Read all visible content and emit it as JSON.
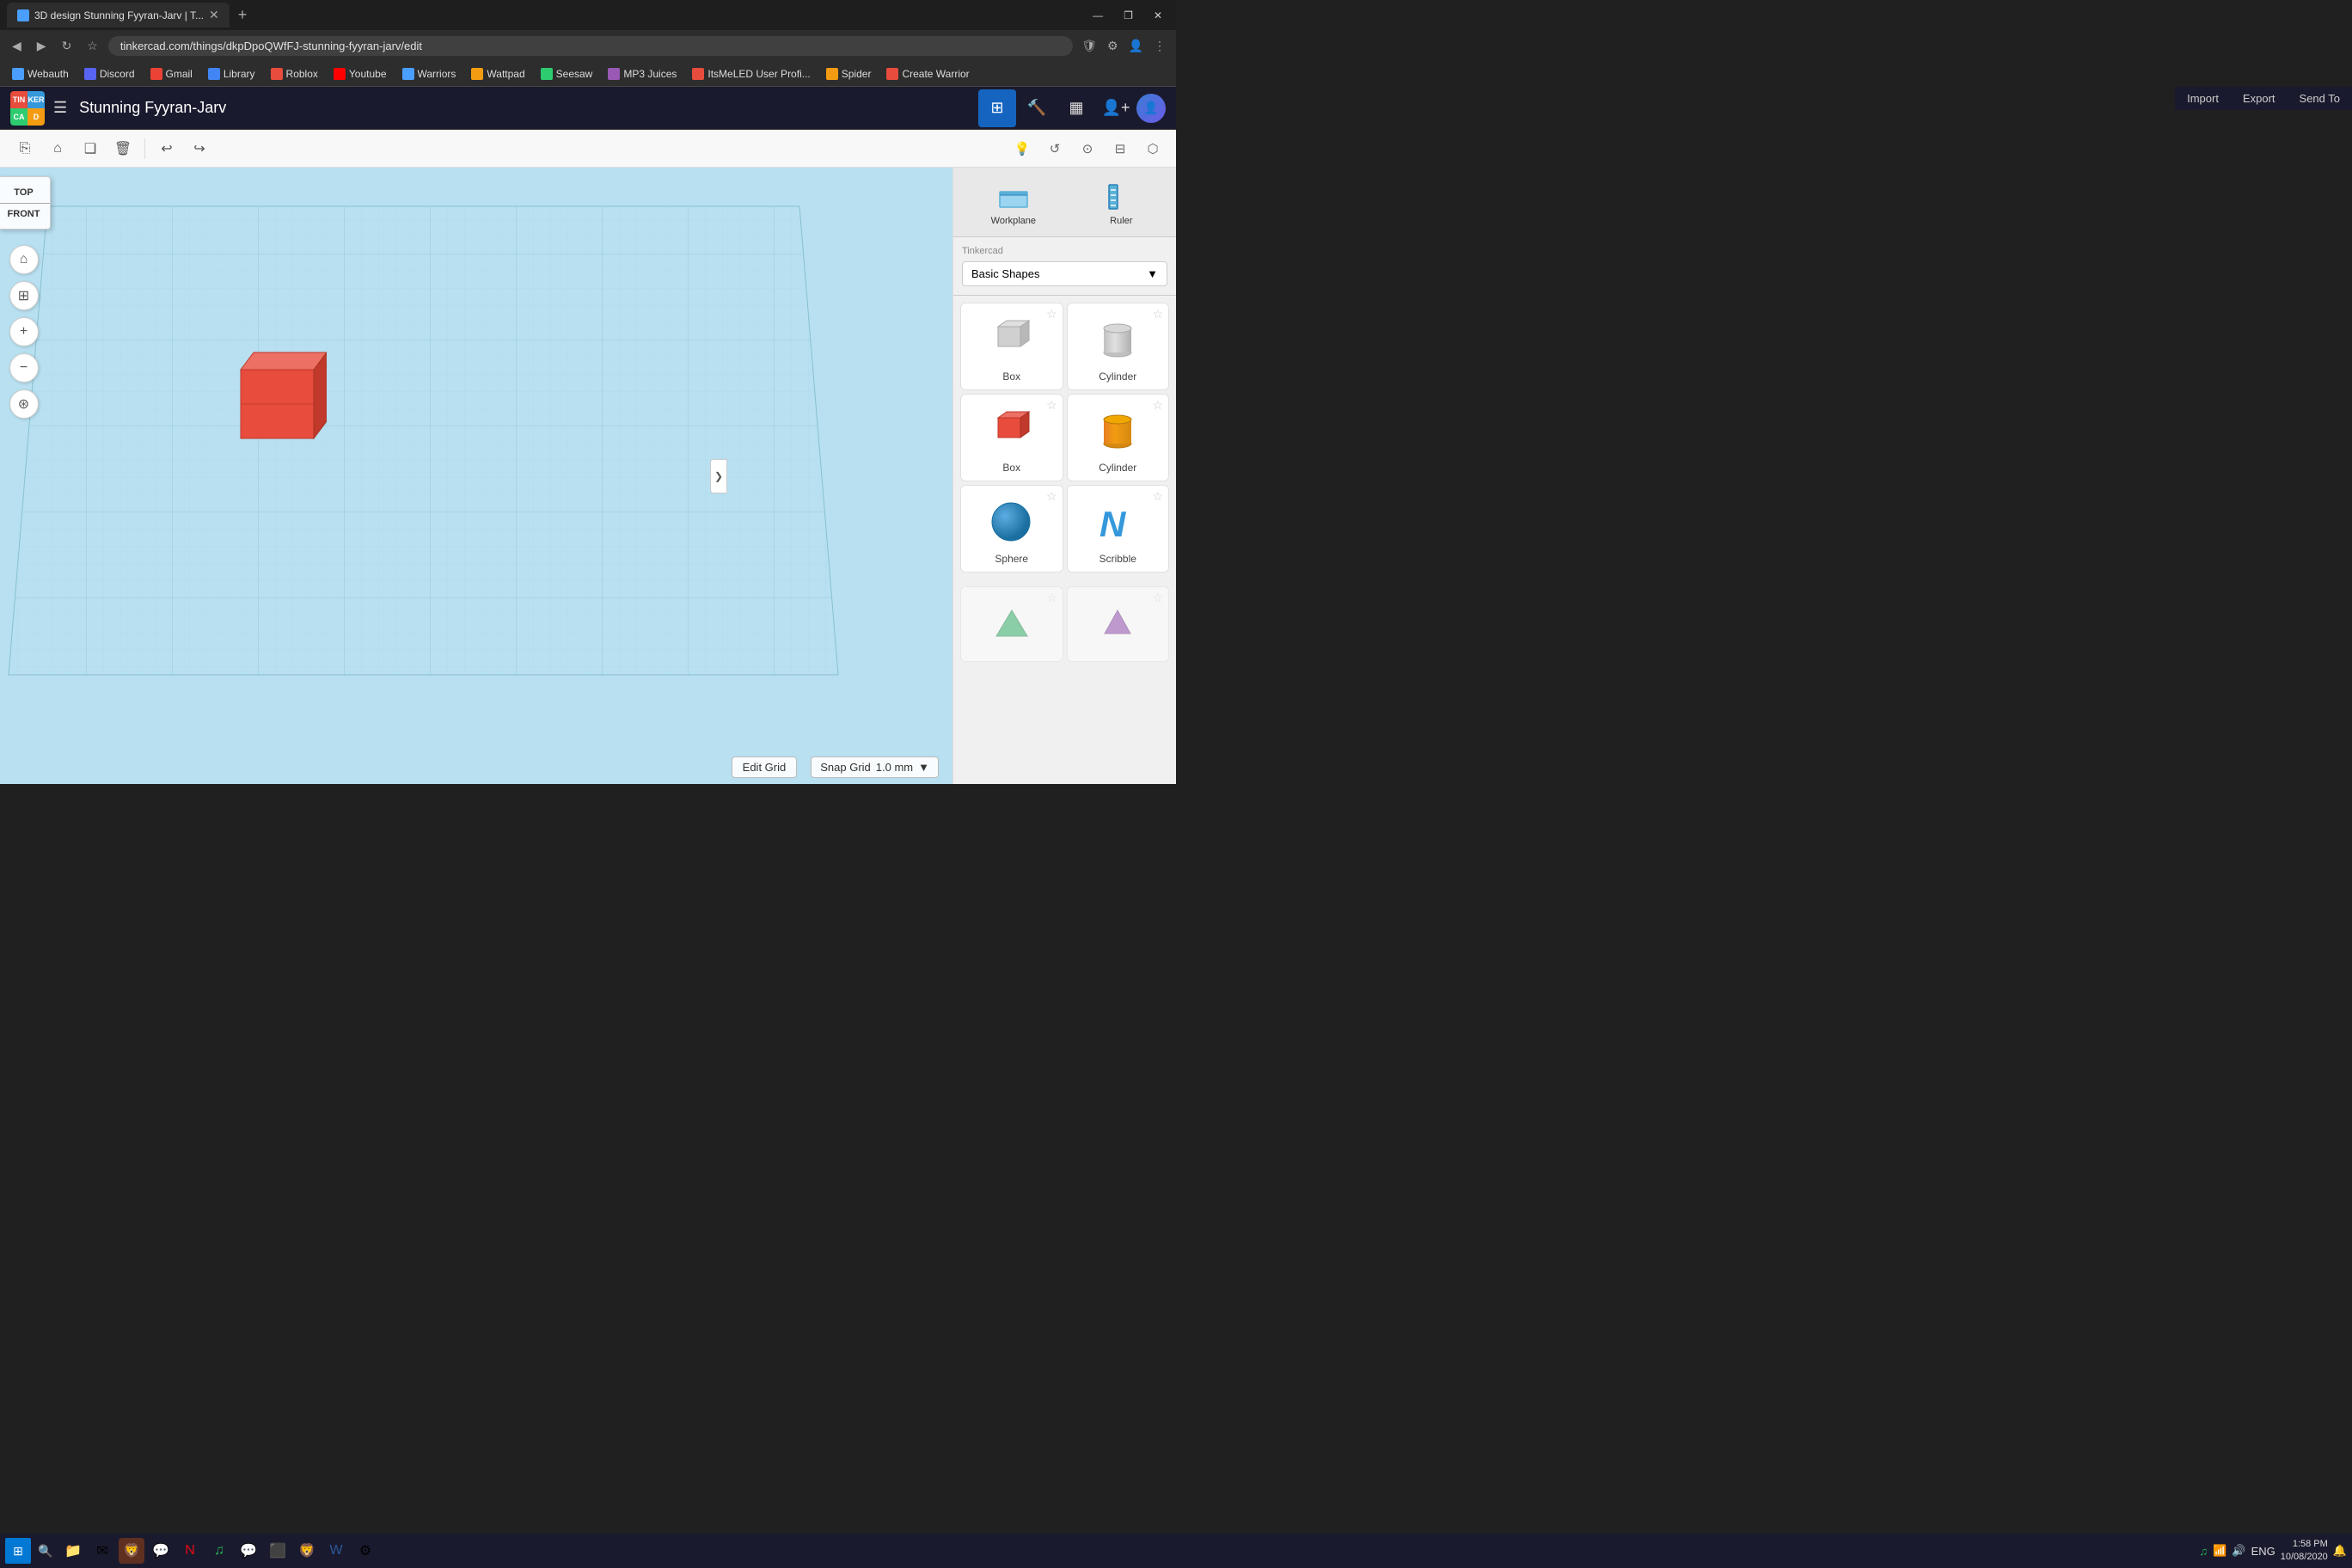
{
  "browser": {
    "tab_title": "3D design Stunning Fyyran-Jarv | T...",
    "url": "tinkercad.com/things/dkpDpoQWfFJ-stunning-fyyran-jarv/edit",
    "nav": {
      "back": "◀",
      "forward": "▶",
      "reload": "↻",
      "bookmark": "☆"
    },
    "window_controls": {
      "minimize": "—",
      "maximize": "❐",
      "close": "✕"
    }
  },
  "bookmarks": [
    {
      "label": "Webauth",
      "color": "#4a9eff"
    },
    {
      "label": "Discord",
      "color": "#5865f2"
    },
    {
      "label": "Gmail",
      "color": "#ea4335"
    },
    {
      "label": "Library",
      "color": "#4285f4"
    },
    {
      "label": "Roblox",
      "color": "#e74c3c"
    },
    {
      "label": "Youtube",
      "color": "#ff0000"
    },
    {
      "label": "Warriors",
      "color": "#4a9eff"
    },
    {
      "label": "Wattpad",
      "color": "#f39c12"
    },
    {
      "label": "Seesaw",
      "color": "#2ecc71"
    },
    {
      "label": "MP3 Juices",
      "color": "#9b59b6"
    },
    {
      "label": "ItsMeLED User Profi...",
      "color": "#e74c3c"
    },
    {
      "label": "Spider",
      "color": "#f39c12"
    },
    {
      "label": "Create Warrior",
      "color": "#e74c3c"
    }
  ],
  "app": {
    "logo_letters": [
      "TIN",
      "KER",
      "CA",
      "D"
    ],
    "logo_cells": [
      "T",
      "I",
      "N",
      "K"
    ],
    "title": "Stunning Fyyran-Jarv",
    "toolbar_buttons": [
      {
        "name": "copy",
        "icon": "⎘"
      },
      {
        "name": "paste",
        "icon": "📋"
      },
      {
        "name": "duplicate",
        "icon": "❑"
      },
      {
        "name": "delete",
        "icon": "🗑"
      },
      {
        "name": "undo",
        "icon": "↩"
      },
      {
        "name": "redo",
        "icon": "↪"
      }
    ],
    "right_toolbar": [
      {
        "name": "light",
        "icon": "💡"
      },
      {
        "name": "rotate",
        "icon": "↺"
      },
      {
        "name": "camera",
        "icon": "⊙"
      },
      {
        "name": "align",
        "icon": "⊟"
      },
      {
        "name": "flip",
        "icon": "⬡"
      }
    ],
    "header_actions": [
      {
        "label": "Import"
      },
      {
        "label": "Export"
      },
      {
        "label": "Send To"
      }
    ]
  },
  "view_cube": {
    "top": "TOP",
    "front": "FRONT"
  },
  "sidebar_buttons": [
    {
      "name": "home",
      "icon": "⌂"
    },
    {
      "name": "fit",
      "icon": "⊞"
    },
    {
      "name": "zoom-in",
      "icon": "+"
    },
    {
      "name": "zoom-out",
      "icon": "−"
    },
    {
      "name": "orbit",
      "icon": "⊛"
    }
  ],
  "right_panel": {
    "tabs": [
      {
        "name": "grid",
        "icon": "⊞",
        "active": true
      },
      {
        "name": "build",
        "icon": "🔨",
        "active": false
      },
      {
        "name": "layers",
        "icon": "▦",
        "active": false
      }
    ],
    "actions": [
      "Import",
      "Export",
      "Send To"
    ],
    "workplane_label": "Workplane",
    "ruler_label": "Ruler",
    "shapes_category": "Tinkercad",
    "shapes_subcategory": "Basic Shapes",
    "shapes": [
      {
        "label": "Box",
        "type": "box-gray"
      },
      {
        "label": "Cylinder",
        "type": "cyl-gray"
      },
      {
        "label": "Box",
        "type": "box-red"
      },
      {
        "label": "Cylinder",
        "type": "cyl-orange"
      },
      {
        "label": "Sphere",
        "type": "sphere"
      },
      {
        "label": "Scribble",
        "type": "scribble"
      }
    ]
  },
  "canvas": {
    "edit_grid_label": "Edit Grid",
    "snap_grid_label": "Snap Grid",
    "snap_grid_value": "1.0 mm",
    "snap_grid_unit": "▼"
  },
  "taskbar": {
    "time": "1:58 PM",
    "date": "10/08/2020",
    "language": "ENG"
  }
}
